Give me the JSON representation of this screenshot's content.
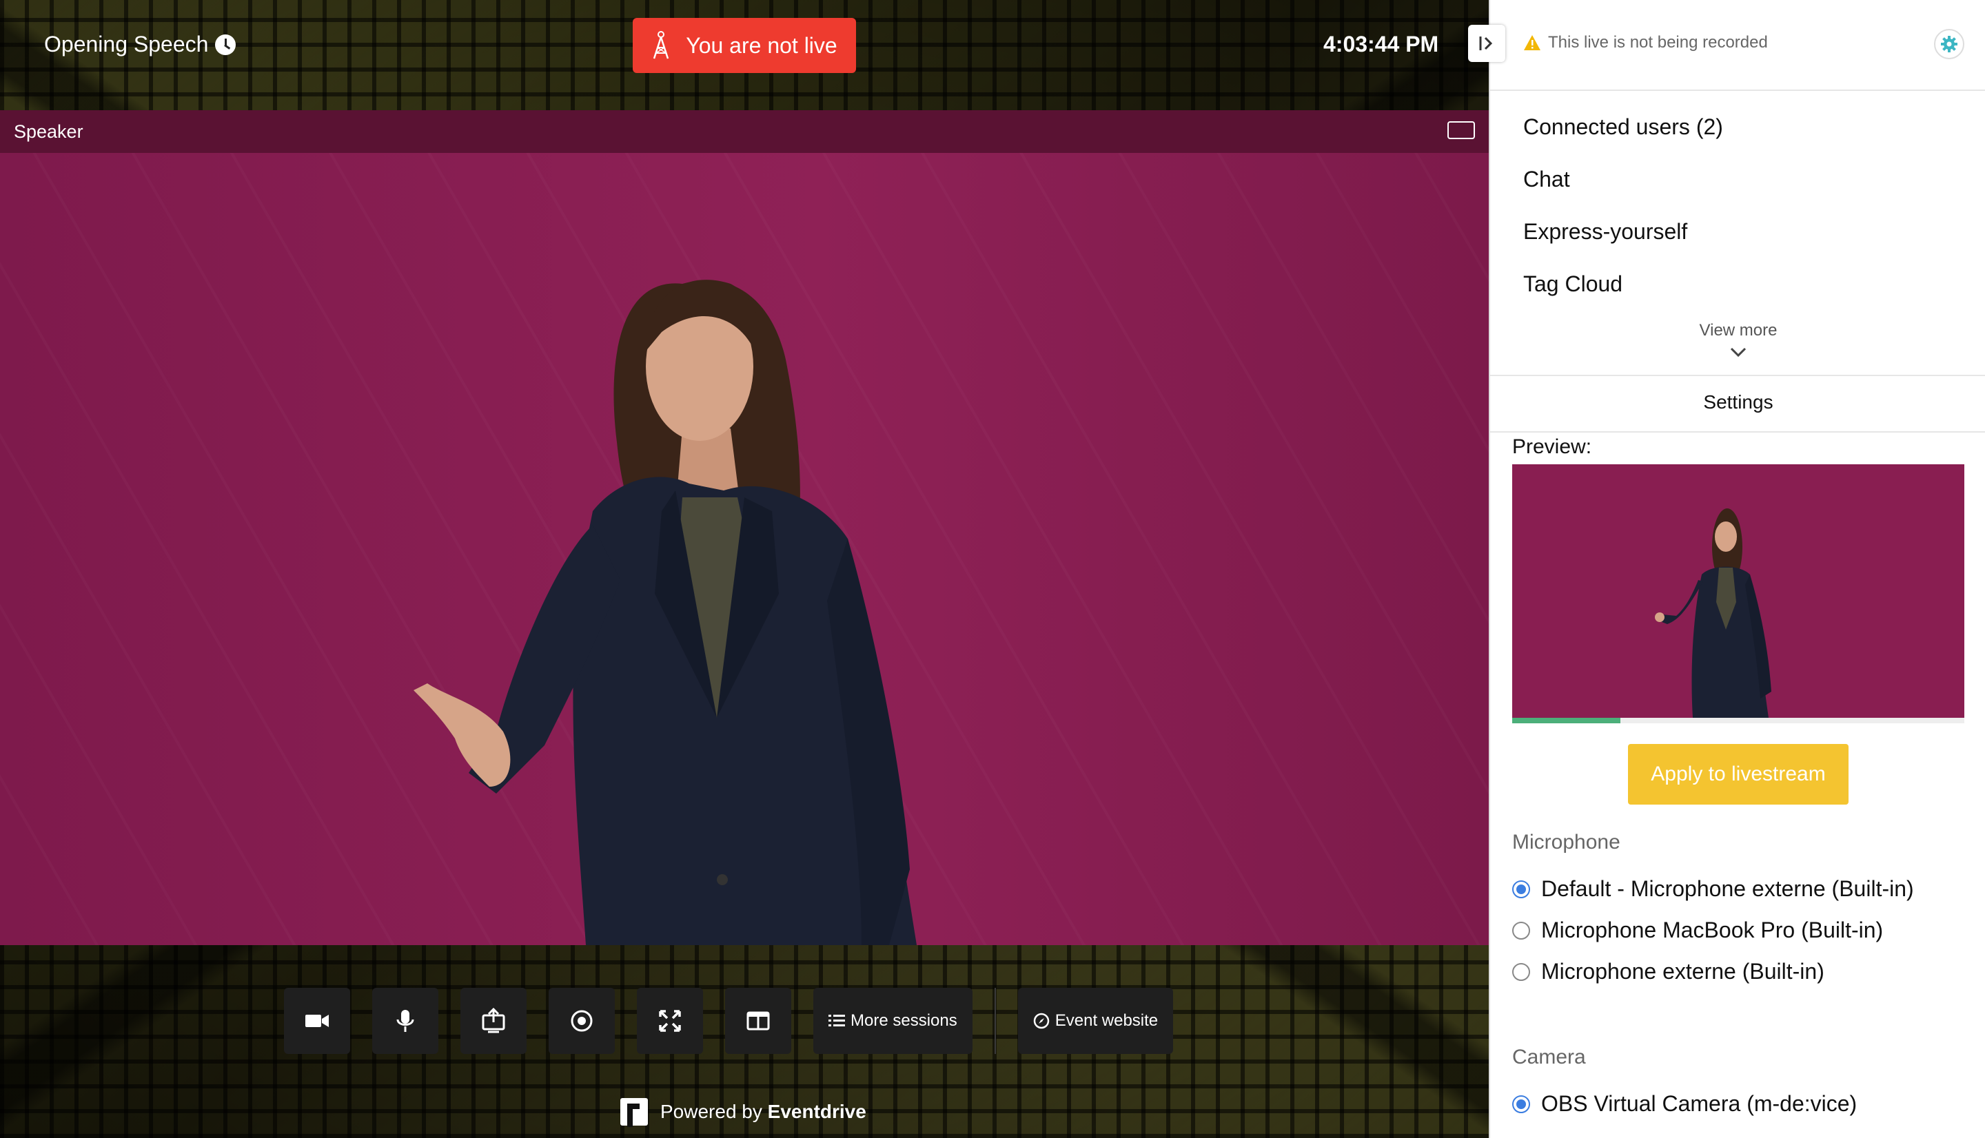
{
  "session": {
    "title": "Opening Speech",
    "time": "4:03:44 PM"
  },
  "live_status": {
    "label": "You are not live",
    "color": "#ee3b2f"
  },
  "video": {
    "header": "Speaker",
    "background": "#8a1f52"
  },
  "toolbar": {
    "icons": [
      "camera-icon",
      "microphone-icon",
      "share-screen-icon",
      "record-icon",
      "fullscreen-icon",
      "layout-icon"
    ],
    "more_sessions": "More sessions",
    "event_website": "Event website"
  },
  "footer": {
    "powered_prefix": "Powered by",
    "brand": "Eventdrive"
  },
  "sidebar": {
    "record_warning": "This live is not being recorded",
    "nav": [
      "Connected users (2)",
      "Chat",
      "Express-yourself",
      "Tag Cloud"
    ],
    "view_more": "View more",
    "settings_title": "Settings",
    "preview_label": "Preview:",
    "preview_level": 0.24,
    "apply_button": "Apply to livestream",
    "apply_color": "#f4c430",
    "microphone_label": "Microphone",
    "microphones": [
      {
        "label": "Default - Microphone externe (Built-in)",
        "checked": true
      },
      {
        "label": "Microphone MacBook Pro (Built-in)",
        "checked": false
      },
      {
        "label": "Microphone externe (Built-in)",
        "checked": false
      }
    ],
    "camera_label": "Camera",
    "cameras": [
      {
        "label": "OBS Virtual Camera (m-de:vice)",
        "checked": true
      }
    ]
  }
}
